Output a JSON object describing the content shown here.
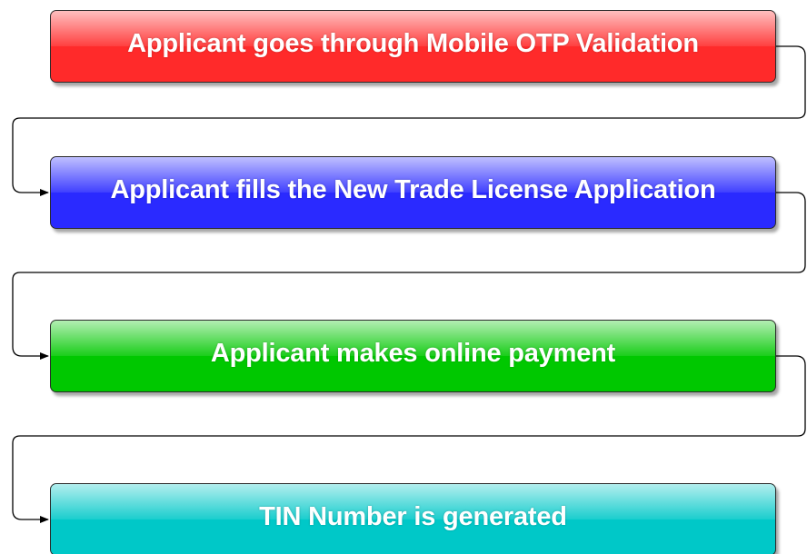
{
  "diagram": {
    "steps": [
      {
        "label": "Applicant goes through Mobile OTP Validation",
        "color": "#ff2a2a"
      },
      {
        "label": "Applicant fills the New Trade License Application",
        "color": "#2a2aff"
      },
      {
        "label": "Applicant makes online payment",
        "color": "#00c800"
      },
      {
        "label": "TIN Number is generated",
        "color": "#00c8c8"
      }
    ],
    "connector_color": "#000000"
  }
}
